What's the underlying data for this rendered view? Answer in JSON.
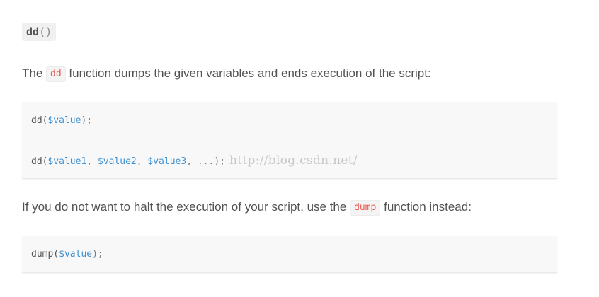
{
  "heading": {
    "func_name": "dd",
    "parens": "()"
  },
  "para1": {
    "prefix": "The",
    "code": "dd",
    "suffix": "function dumps the given variables and ends execution of the script:"
  },
  "code_block_1": {
    "line1": {
      "func": "dd(",
      "arg": "$value",
      "close": ");"
    },
    "line2": {
      "func": "dd(",
      "arg1": "$value1",
      "sep1": ", ",
      "arg2": "$value2",
      "sep2": ", ",
      "arg3": "$value3",
      "rest": ", ...);"
    },
    "watermark": "http://blog.csdn.net/"
  },
  "para2": {
    "prefix": "If you do not want to halt the execution of your script, use the",
    "code": "dump",
    "suffix": "function instead:"
  },
  "code_block_2": {
    "line1": {
      "func": "dump(",
      "arg": "$value",
      "close": ");"
    }
  },
  "colors": {
    "inline_code": "#e8554e",
    "variable": "#3c8fd0",
    "text": "#525252",
    "code_bg": "#f8f8f8"
  }
}
